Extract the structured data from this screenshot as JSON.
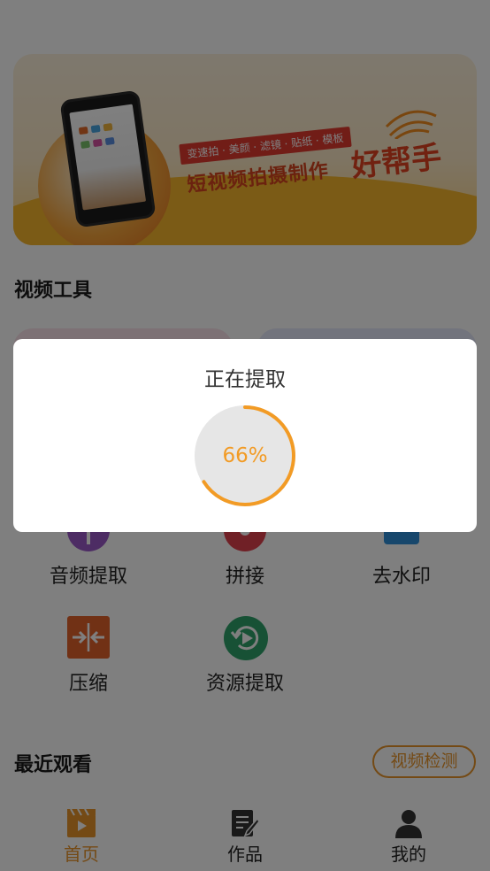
{
  "banner": {
    "tagline": "变速拍 · 美颜 · 滤镜 · 贴纸 · 模板",
    "slogan": "短视频拍摄制作",
    "slogan_big": "好帮手"
  },
  "video_tools": {
    "title": "视频工具"
  },
  "tools": [
    {
      "label": "音频提取",
      "icon": "audio-extract-icon"
    },
    {
      "label": "拼接",
      "icon": "splice-icon"
    },
    {
      "label": "去水印",
      "icon": "remove-watermark-icon"
    },
    {
      "label": "压缩",
      "icon": "compress-icon"
    },
    {
      "label": "资源提取",
      "icon": "resource-extract-icon"
    }
  ],
  "recent": {
    "title": "最近观看",
    "detect_button": "视频检测"
  },
  "tabbar": {
    "items": [
      {
        "label": "首页",
        "icon": "home-clapper-icon",
        "active": true
      },
      {
        "label": "作品",
        "icon": "works-edit-icon",
        "active": false
      },
      {
        "label": "我的",
        "icon": "profile-icon",
        "active": false
      }
    ]
  },
  "dialog": {
    "title": "正在提取",
    "progress_percent": 66,
    "progress_label": "66%"
  },
  "colors": {
    "accent": "#f29b25",
    "tab_active": "#e9952a",
    "compress": "#e3622b",
    "resource": "#2fa36b",
    "audio": "#9a58c9",
    "splice": "#e0414d",
    "watermark": "#2f8fd8"
  }
}
